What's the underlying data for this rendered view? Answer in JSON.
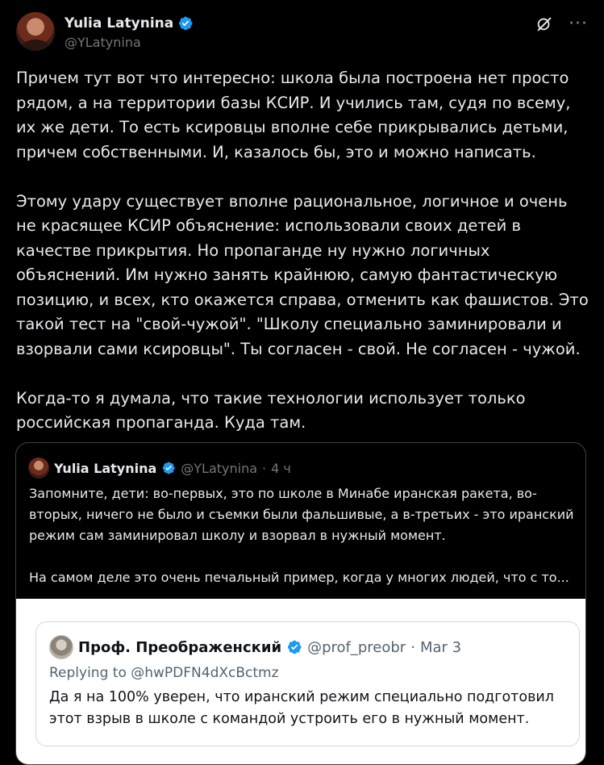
{
  "author": {
    "name": "Yulia Latynina",
    "handle": "@YLatynina",
    "verified": true
  },
  "header_actions": {
    "grok_icon": "grok-icon",
    "more_label": "···"
  },
  "tweet": {
    "paragraphs": [
      "Причем тут вот что интересно: школа была построена нет просто рядом, а на территории базы КСИР. И учились там, судя по всему, их же дети. То есть ксировцы вполне себе прикрывались детьми, причем собственными. И, казалось бы, это и можно написать.",
      "Этому удару существует вполне рациональное, логичное и очень не красящее КСИР объяснение: использовали своих детей в качестве прикрытия. Но пропаганде ну нужно логичных объяснений. Им нужно занять крайнюю, самую фантастическую позицию, и всех, кто окажется справа, отменить как фашистов. Это такой тест на \"свой-чужой\". \"Школу специально заминировали и взорвали сами ксировцы\". Ты согласен - свой. Не согласен - чужой.",
      "Когда-то я думала, что такие технологии использует только российская пропаганда. Куда там."
    ]
  },
  "quoted": {
    "name": "Yulia Latynina",
    "handle": "@YLatynina",
    "separator": "·",
    "time": "4 ч",
    "paragraph1": "Запомните, дети: во-первых, это по школе в Минабе иранская ракета, во-вторых, ничего не было и съемки были фальшивые, а в-третьих - это иранский режим сам заминировал школу и взорвал в нужный момент.",
    "paragraph2": "На самом деле это очень печальный пример, когда у многих людей, что с то..."
  },
  "inner_card": {
    "name": "Проф. Преображенский",
    "handle": "@prof_preobr",
    "separator": "·",
    "date": "Mar 3",
    "reply_to": "Replying to @hwPDFN4dXcBctmz",
    "text": "Да я на 100% уверен, что иранский режим специально подготовил этот взрыв в школе с командой устроить его в нужный момент."
  },
  "colors": {
    "background": "#000000",
    "text": "#e7e9ea",
    "muted": "#71767b",
    "verified": "#1d9bf0",
    "border": "#3e4144"
  }
}
